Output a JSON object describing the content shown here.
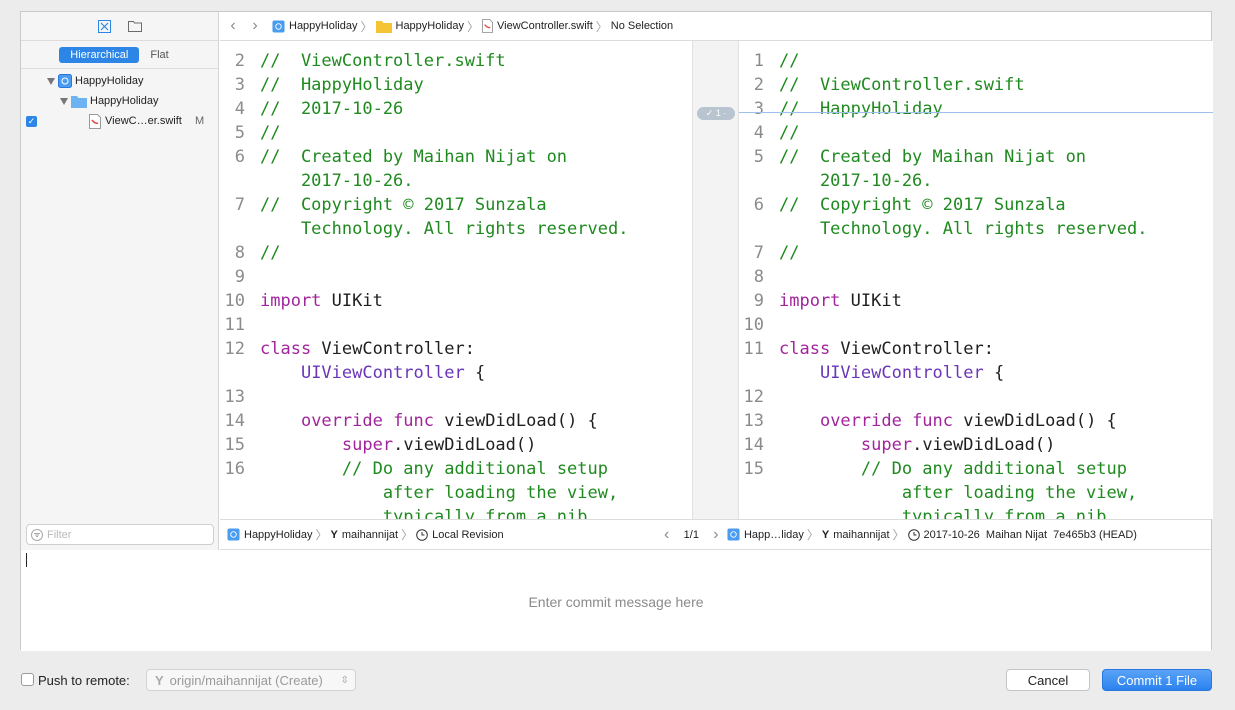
{
  "sidebar": {
    "segments": [
      "Hierarchical",
      "Flat"
    ],
    "tree": [
      {
        "label": "HappyHoliday",
        "kind": "project"
      },
      {
        "label": "HappyHoliday",
        "kind": "folder"
      },
      {
        "label": "ViewC…er.swift",
        "kind": "swift-file",
        "status": "M",
        "checked": true
      }
    ],
    "filter_placeholder": "Filter"
  },
  "jumpbar": {
    "crumbs": [
      "HappyHoliday",
      "HappyHoliday",
      "ViewController.swift",
      "No Selection"
    ]
  },
  "left_pane": {
    "lines": [
      {
        "num": "2",
        "parts": [
          [
            "cmt",
            "//  ViewController.swift"
          ]
        ]
      },
      {
        "num": "3",
        "parts": [
          [
            "cmt",
            "//  HappyHoliday"
          ]
        ]
      },
      {
        "num": "4",
        "parts": [
          [
            "cmt",
            "//  2017-10-26"
          ]
        ],
        "highlight": true
      },
      {
        "num": "5",
        "parts": [
          [
            "cmt",
            "//"
          ]
        ]
      },
      {
        "num": "6",
        "parts": [
          [
            "cmt",
            "//  Created by Maihan Nijat on"
          ]
        ]
      },
      {
        "num": "",
        "parts": [
          [
            "cmt",
            "    2017-10-26."
          ]
        ]
      },
      {
        "num": "7",
        "parts": [
          [
            "cmt",
            "//  Copyright © 2017 Sunzala"
          ]
        ]
      },
      {
        "num": "",
        "parts": [
          [
            "cmt",
            "    Technology. All rights reserved."
          ]
        ]
      },
      {
        "num": "8",
        "parts": [
          [
            "cmt",
            "//"
          ]
        ]
      },
      {
        "num": "9",
        "parts": [
          [
            "txt",
            ""
          ]
        ]
      },
      {
        "num": "10",
        "parts": [
          [
            "kw",
            "import"
          ],
          [
            "txt",
            " UIKit"
          ]
        ]
      },
      {
        "num": "11",
        "parts": [
          [
            "txt",
            ""
          ]
        ]
      },
      {
        "num": "12",
        "parts": [
          [
            "kw",
            "class"
          ],
          [
            "txt",
            " ViewController:"
          ]
        ]
      },
      {
        "num": "",
        "parts": [
          [
            "txt",
            "    "
          ],
          [
            "ty",
            "UIViewController"
          ],
          [
            "txt",
            " {"
          ]
        ]
      },
      {
        "num": "13",
        "parts": [
          [
            "txt",
            ""
          ]
        ]
      },
      {
        "num": "14",
        "parts": [
          [
            "txt",
            "    "
          ],
          [
            "kw",
            "override func"
          ],
          [
            "txt",
            " viewDidLoad() {"
          ]
        ]
      },
      {
        "num": "15",
        "parts": [
          [
            "txt",
            "        "
          ],
          [
            "kw",
            "super"
          ],
          [
            "txt",
            ".viewDidLoad()"
          ]
        ]
      },
      {
        "num": "16",
        "parts": [
          [
            "txt",
            "        "
          ],
          [
            "cmt",
            "// Do any additional setup"
          ]
        ]
      },
      {
        "num": "",
        "parts": [
          [
            "cmt",
            "            after loading the view,"
          ]
        ]
      },
      {
        "num": "",
        "parts": [
          [
            "cmt",
            "            typically from a nib."
          ]
        ]
      }
    ]
  },
  "right_pane": {
    "lines": [
      {
        "num": "1",
        "parts": [
          [
            "cmt",
            "//"
          ]
        ]
      },
      {
        "num": "2",
        "parts": [
          [
            "cmt",
            "//  ViewController.swift"
          ]
        ]
      },
      {
        "num": "3",
        "parts": [
          [
            "cmt",
            "//  HappyHoliday"
          ]
        ]
      },
      {
        "num": "4",
        "parts": [
          [
            "cmt",
            "//"
          ]
        ]
      },
      {
        "num": "5",
        "parts": [
          [
            "cmt",
            "//  Created by Maihan Nijat on"
          ]
        ]
      },
      {
        "num": "",
        "parts": [
          [
            "cmt",
            "    2017-10-26."
          ]
        ]
      },
      {
        "num": "6",
        "parts": [
          [
            "cmt",
            "//  Copyright © 2017 Sunzala"
          ]
        ]
      },
      {
        "num": "",
        "parts": [
          [
            "cmt",
            "    Technology. All rights reserved."
          ]
        ]
      },
      {
        "num": "7",
        "parts": [
          [
            "cmt",
            "//"
          ]
        ]
      },
      {
        "num": "8",
        "parts": [
          [
            "txt",
            ""
          ]
        ]
      },
      {
        "num": "9",
        "parts": [
          [
            "kw",
            "import"
          ],
          [
            "txt",
            " UIKit"
          ]
        ]
      },
      {
        "num": "10",
        "parts": [
          [
            "txt",
            ""
          ]
        ]
      },
      {
        "num": "11",
        "parts": [
          [
            "kw",
            "class"
          ],
          [
            "txt",
            " ViewController:"
          ]
        ]
      },
      {
        "num": "",
        "parts": [
          [
            "txt",
            "    "
          ],
          [
            "ty",
            "UIViewController"
          ],
          [
            "txt",
            " {"
          ]
        ]
      },
      {
        "num": "12",
        "parts": [
          [
            "txt",
            ""
          ]
        ]
      },
      {
        "num": "13",
        "parts": [
          [
            "txt",
            "    "
          ],
          [
            "kw",
            "override func"
          ],
          [
            "txt",
            " viewDidLoad() {"
          ]
        ]
      },
      {
        "num": "14",
        "parts": [
          [
            "txt",
            "        "
          ],
          [
            "kw",
            "super"
          ],
          [
            "txt",
            ".viewDidLoad()"
          ]
        ]
      },
      {
        "num": "15",
        "parts": [
          [
            "txt",
            "        "
          ],
          [
            "cmt",
            "// Do any additional setup"
          ]
        ]
      },
      {
        "num": "",
        "parts": [
          [
            "cmt",
            "            after loading the view,"
          ]
        ]
      },
      {
        "num": "",
        "parts": [
          [
            "cmt",
            "            typically from a nib."
          ]
        ]
      }
    ]
  },
  "gutter": {
    "change_badge": "✓ 1 ·"
  },
  "bottombar": {
    "left_project": "HappyHoliday",
    "left_branch": "maihannijat",
    "left_revision": "Local Revision",
    "page": "1/1",
    "right_project": "Happ…liday",
    "right_branch": "maihannijat",
    "right_revision": "2017-10-26  Maihan Nijat  7e465b3 (HEAD)"
  },
  "commit": {
    "placeholder": "Enter commit message here"
  },
  "footer": {
    "push_label": "Push to remote:",
    "remote_value": "origin/maihannijat (Create)",
    "cancel_label": "Cancel",
    "commit_label": "Commit 1 File"
  },
  "colors": {
    "accent": "#2d86e6",
    "comment": "#1f8a1f",
    "keyword": "#a2249c",
    "type": "#6a36b8"
  }
}
